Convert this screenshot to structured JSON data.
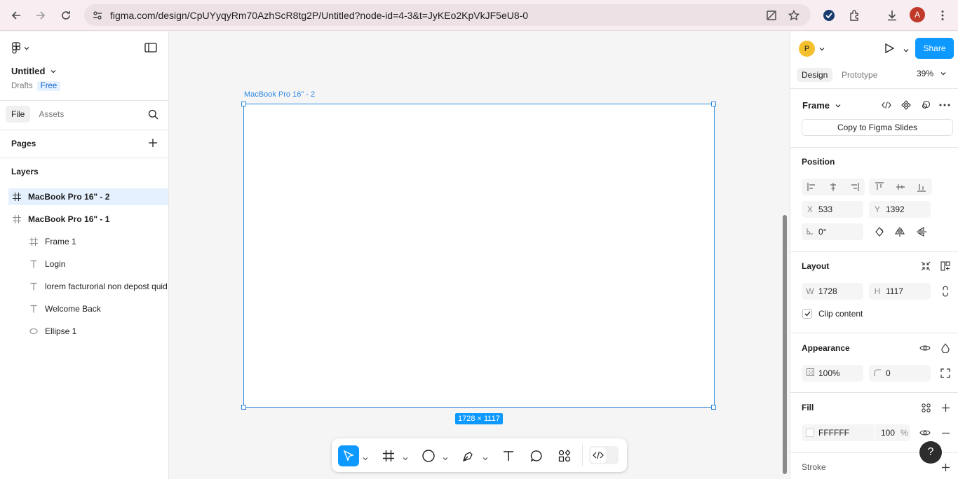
{
  "browser": {
    "url": "figma.com/design/CpUYyqyRm70AzhScR8tg2P/Untitled?node-id=4-3&t=JyKEo2KpVkJF5eU8-0",
    "profile_initial": "A"
  },
  "left_panel": {
    "file_name": "Untitled",
    "location": "Drafts",
    "plan_badge": "Free",
    "tabs": [
      "File",
      "Assets"
    ],
    "pages_heading": "Pages",
    "layers_heading": "Layers",
    "layers": [
      {
        "name": "MacBook Pro 16\" - 2",
        "icon": "frame-icon",
        "selected": true
      },
      {
        "name": "MacBook Pro 16\" - 1",
        "icon": "frame-icon"
      },
      {
        "name": "Frame 1",
        "icon": "frame-icon"
      },
      {
        "name": "Login",
        "icon": "text-icon"
      },
      {
        "name": "lorem facturorial non depost quid",
        "icon": "text-icon"
      },
      {
        "name": "Welcome Back",
        "icon": "text-icon"
      },
      {
        "name": "Ellipse 1",
        "icon": "ellipse-icon"
      }
    ]
  },
  "canvas": {
    "frame_label": "MacBook Pro 16\" - 2",
    "size_badge": "1728 × 1117"
  },
  "right_panel": {
    "user_initial": "P",
    "share_label": "Share",
    "tabs": [
      "Design",
      "Prototype"
    ],
    "zoom": "39%",
    "frame_type": "Frame",
    "copy_slides_label": "Copy to Figma Slides",
    "position_heading": "Position",
    "x_label": "X",
    "x_value": "533",
    "y_label": "Y",
    "y_value": "1392",
    "rotation": "0°",
    "layout_heading": "Layout",
    "w_label": "W",
    "w_value": "1728",
    "h_label": "H",
    "h_value": "1117",
    "clip_content_label": "Clip content",
    "appearance_heading": "Appearance",
    "opacity": "100%",
    "corner_radius": "0",
    "fill_heading": "Fill",
    "fill_hex": "FFFFFF",
    "fill_opacity": "100",
    "fill_percent": "%",
    "stroke_heading": "Stroke",
    "help_label": "?"
  },
  "colors": {
    "accent": "#0d99ff",
    "selection": "#2f8ae0",
    "canvas_bg": "#f5f5f5"
  }
}
